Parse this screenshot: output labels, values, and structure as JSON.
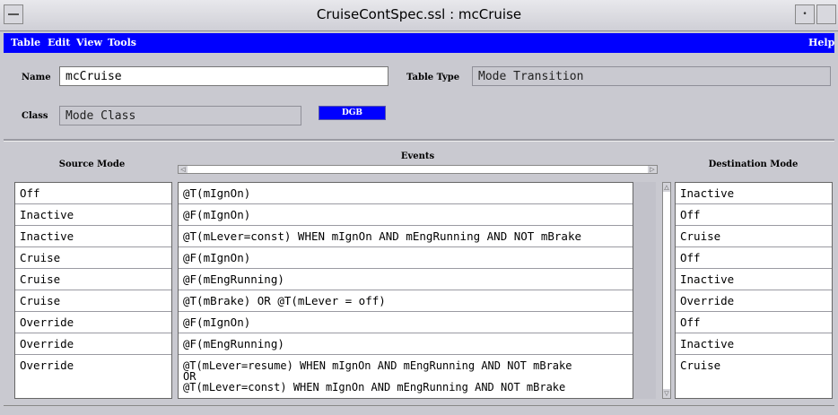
{
  "window": {
    "title": "CruiseContSpec.ssl : mcCruise"
  },
  "menubar": {
    "items": [
      "Table",
      "Edit",
      "View",
      "Tools"
    ],
    "help": "Help"
  },
  "form": {
    "name_label": "Name",
    "name_value": "mcCruise",
    "table_type_label": "Table Type",
    "table_type_value": "Mode Transition",
    "class_label": "Class",
    "class_value": "Mode Class",
    "dgb_button": "DGB"
  },
  "table": {
    "headers": {
      "source": "Source Mode",
      "events": "Events",
      "destination": "Destination Mode"
    },
    "rows": [
      {
        "source": "Off",
        "event": "@T(mIgnOn)",
        "dest": "Inactive"
      },
      {
        "source": "Inactive",
        "event": "@F(mIgnOn)",
        "dest": "Off"
      },
      {
        "source": "Inactive",
        "event": "@T(mLever=const) WHEN mIgnOn AND mEngRunning AND NOT mBrake",
        "dest": "Cruise"
      },
      {
        "source": "Cruise",
        "event": "@F(mIgnOn)",
        "dest": "Off"
      },
      {
        "source": "Cruise",
        "event": "@F(mEngRunning)",
        "dest": "Inactive"
      },
      {
        "source": "Cruise",
        "event": "@T(mBrake) OR @T(mLever = off)",
        "dest": "Override"
      },
      {
        "source": "Override",
        "event": "@F(mIgnOn)",
        "dest": "Off"
      },
      {
        "source": "Override",
        "event": "@F(mEngRunning)",
        "dest": "Inactive"
      },
      {
        "source": "Override",
        "event": "@T(mLever=resume) WHEN mIgnOn AND mEngRunning AND NOT mBrake\nOR\n@T(mLever=const) WHEN mIgnOn AND mEngRunning AND NOT mBrake",
        "dest": "Cruise"
      }
    ]
  }
}
